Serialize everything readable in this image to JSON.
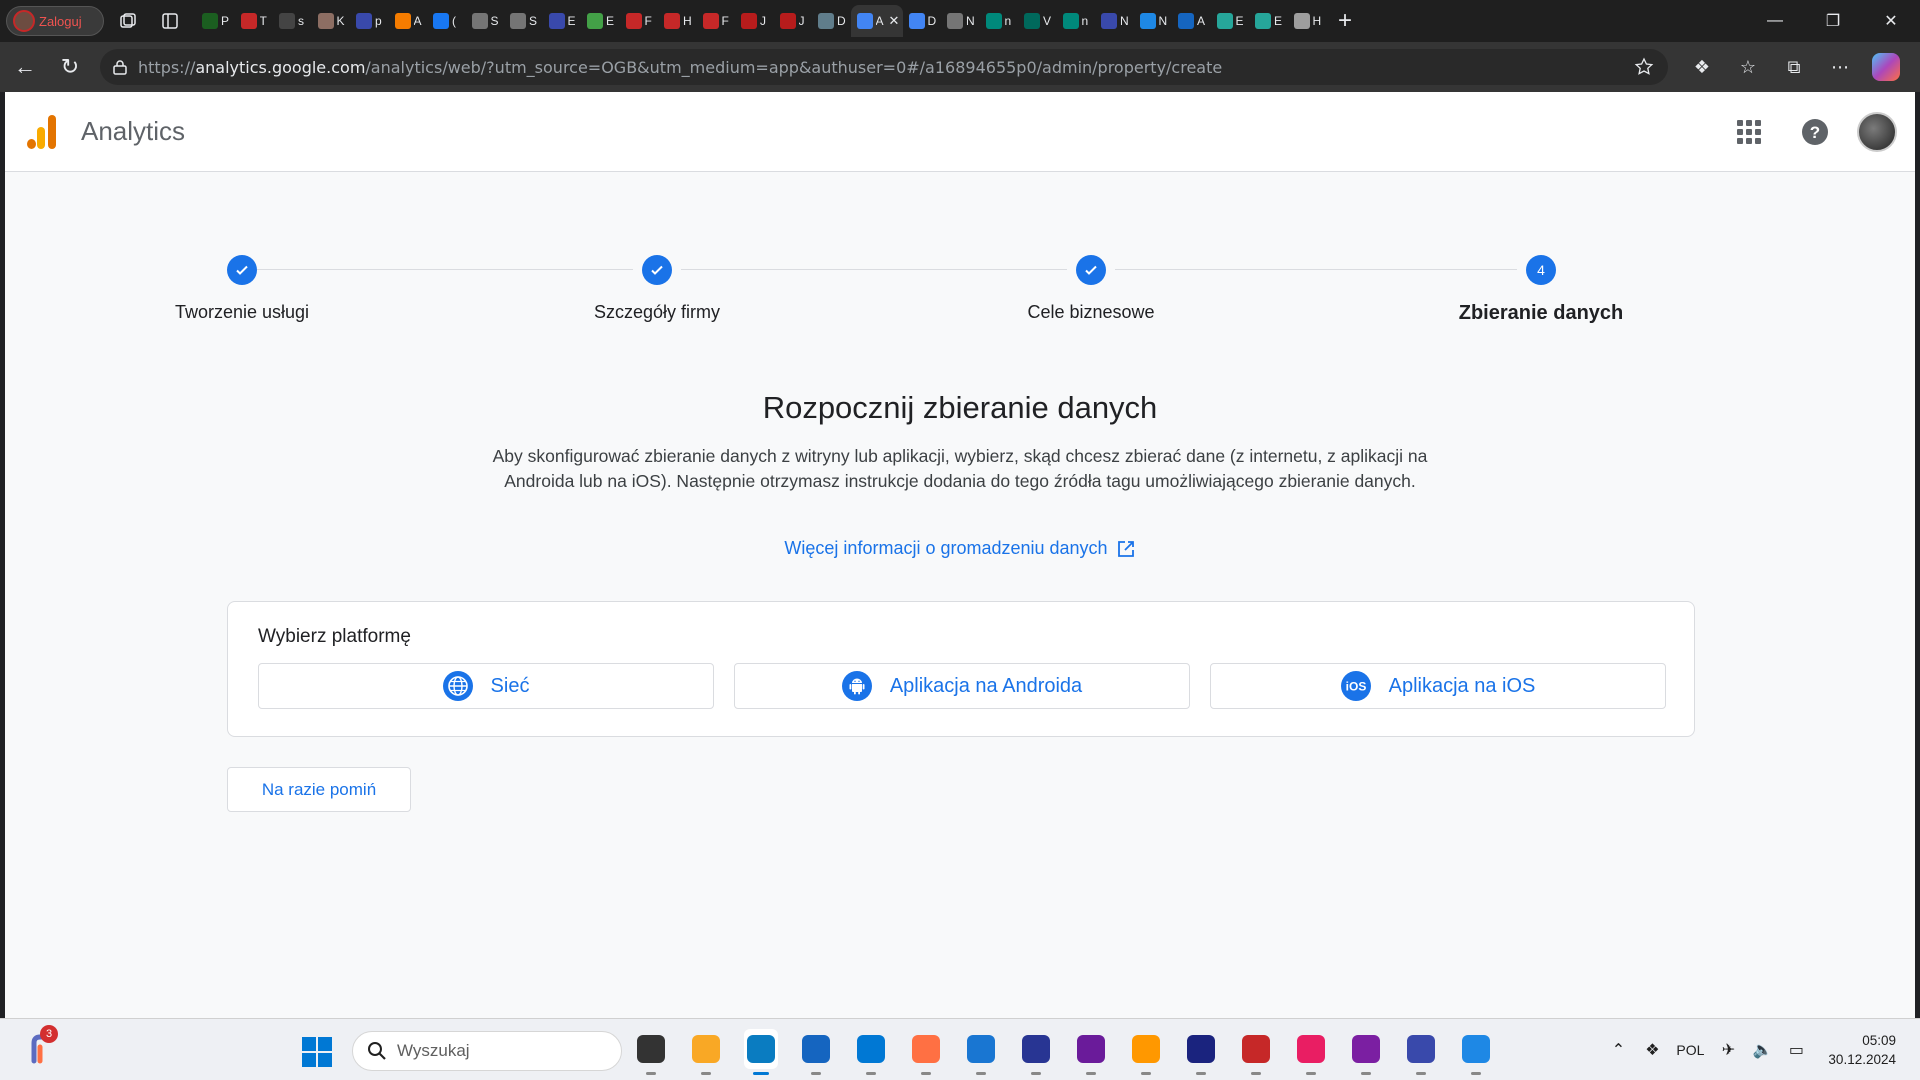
{
  "browser": {
    "profile_label": "Zaloguj",
    "tabs": [
      {
        "letter": "P",
        "color": "#1b5e20"
      },
      {
        "letter": "T",
        "color": "#c62828"
      },
      {
        "letter": "s",
        "color": "#444"
      },
      {
        "letter": "K",
        "color": "#8d6e63"
      },
      {
        "letter": "p",
        "color": "#3949ab"
      },
      {
        "letter": "A",
        "color": "#f57c00"
      },
      {
        "letter": "(",
        "color": "#1877f2"
      },
      {
        "letter": "S",
        "color": "#757575"
      },
      {
        "letter": "S",
        "color": "#757575"
      },
      {
        "letter": "E",
        "color": "#3949ab"
      },
      {
        "letter": "E",
        "color": "#43a047"
      },
      {
        "letter": "F",
        "color": "#c62828"
      },
      {
        "letter": "H",
        "color": "#c62828"
      },
      {
        "letter": "F",
        "color": "#c62828"
      },
      {
        "letter": "J",
        "color": "#b71c1c"
      },
      {
        "letter": "J",
        "color": "#b71c1c"
      },
      {
        "letter": "D",
        "color": "#607d8b"
      },
      {
        "letter": "A",
        "color": "#4285f4",
        "active": true
      },
      {
        "letter": "D",
        "color": "#4285f4"
      },
      {
        "letter": "N",
        "color": "#757575"
      },
      {
        "letter": "n",
        "color": "#00897b"
      },
      {
        "letter": "V",
        "color": "#00695c"
      },
      {
        "letter": "n",
        "color": "#00897b"
      },
      {
        "letter": "N",
        "color": "#3949ab"
      },
      {
        "letter": "N",
        "color": "#1e88e5"
      },
      {
        "letter": "A",
        "color": "#1565c0"
      },
      {
        "letter": "E",
        "color": "#26a69a"
      },
      {
        "letter": "E",
        "color": "#26a69a"
      },
      {
        "letter": "H",
        "color": "#9e9e9e"
      }
    ],
    "url_prefix": "https://",
    "url_host": "analytics.google.com",
    "url_path": "/analytics/web/?utm_source=OGB&utm_medium=app&authuser=0#/a16894655p0/admin/property/create"
  },
  "app": {
    "title": "Analytics"
  },
  "stepper": {
    "steps": [
      {
        "label": "Tworzenie usługi",
        "state": "done"
      },
      {
        "label": "Szczegóły firmy",
        "state": "done"
      },
      {
        "label": "Cele biznesowe",
        "state": "done"
      },
      {
        "label": "Zbieranie danych",
        "state": "current",
        "number": "4"
      }
    ]
  },
  "content": {
    "title": "Rozpocznij zbieranie danych",
    "description": "Aby skonfigurować zbieranie danych z witryny lub aplikacji, wybierz, skąd chcesz zbierać dane (z internetu, z aplikacji na Androida lub na iOS). Następnie otrzymasz instrukcje dodania do tego źródła tagu umożliwiającego zbieranie danych.",
    "more_link": "Więcej informacji o gromadzeniu danych"
  },
  "platform": {
    "title": "Wybierz platformę",
    "options": [
      {
        "label": "Sieć",
        "icon": "globe-icon"
      },
      {
        "label": "Aplikacja na Androida",
        "icon": "android-icon"
      },
      {
        "label": "Aplikacja na iOS",
        "icon": "ios-icon"
      }
    ]
  },
  "actions": {
    "skip_label": "Na razie pomiń"
  },
  "taskbar": {
    "widget_badge": "3",
    "search_placeholder": "Wyszukaj",
    "apps": [
      {
        "name": "task-view",
        "color": "#333"
      },
      {
        "name": "file-explorer",
        "color": "#f9a825"
      },
      {
        "name": "edge",
        "color": "#0a7cc1",
        "active": true
      },
      {
        "name": "microsoft-store",
        "color": "#1565c0"
      },
      {
        "name": "outlook",
        "color": "#0078d4"
      },
      {
        "name": "firefox",
        "color": "#ff7043"
      },
      {
        "name": "photos",
        "color": "#1976d2"
      },
      {
        "name": "save-app",
        "color": "#283593"
      },
      {
        "name": "github",
        "color": "#6a1b9a"
      },
      {
        "name": "media-player",
        "color": "#ff9800"
      },
      {
        "name": "virtualbox",
        "color": "#1a237e"
      },
      {
        "name": "davinci",
        "color": "#c62828"
      },
      {
        "name": "gem-app",
        "color": "#e91e63"
      },
      {
        "name": "tor-browser",
        "color": "#7b1fa2"
      },
      {
        "name": "network-app",
        "color": "#3949ab"
      },
      {
        "name": "thunderbird",
        "color": "#1e88e5"
      }
    ],
    "language": "POL",
    "time": "05:09",
    "date": "30.12.2024"
  },
  "colors": {
    "accent": "#1a73e8",
    "ga_orange": "#f9ab00",
    "ga_dark_orange": "#e37400"
  }
}
